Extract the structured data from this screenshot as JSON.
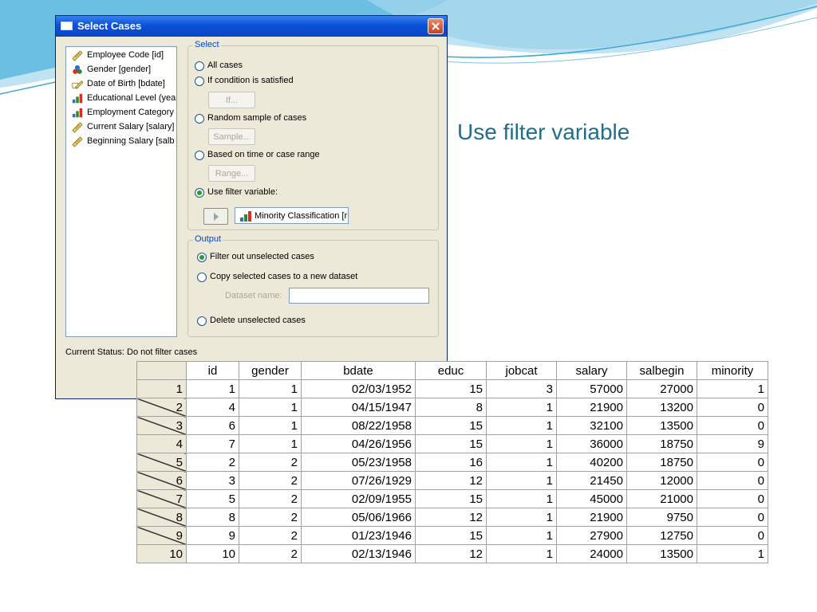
{
  "slide": {
    "title": "Use filter variable"
  },
  "dialog": {
    "title": "Select Cases",
    "variables": [
      {
        "label": "Employee Code [id]",
        "icon": "scale-ruler-icon"
      },
      {
        "label": "Gender [gender]",
        "icon": "nominal-icon"
      },
      {
        "label": "Date of Birth [bdate]",
        "icon": "date-ruler-icon"
      },
      {
        "label": "Educational Level (yea",
        "icon": "ordinal-bar-icon"
      },
      {
        "label": "Employment Category",
        "icon": "ordinal-bar-icon"
      },
      {
        "label": "Current Salary [salary]",
        "icon": "scale-ruler-icon"
      },
      {
        "label": "Beginning Salary [salb",
        "icon": "scale-ruler-icon"
      }
    ],
    "select": {
      "legend": "Select",
      "all_cases": "All cases",
      "if_condition": "If condition is satisfied",
      "if_button": "If...",
      "random_sample": "Random sample of cases",
      "sample_button": "Sample...",
      "time_range": "Based on time or case range",
      "range_button": "Range...",
      "use_filter": "Use filter variable:",
      "filter_variable": "Minority Classification [r",
      "selected": "use_filter"
    },
    "output": {
      "legend": "Output",
      "filter_out": "Filter out unselected cases",
      "copy_dataset": "Copy selected cases to a new dataset",
      "dataset_name_label": "Dataset name:",
      "dataset_name_value": "",
      "delete_unselected": "Delete unselected cases",
      "selected": "filter_out"
    },
    "status": "Current Status: Do not filter cases"
  },
  "table": {
    "columns": [
      "id",
      "gender",
      "bdate",
      "educ",
      "jobcat",
      "salary",
      "salbegin",
      "minority"
    ],
    "rows": [
      {
        "num": "1",
        "filtered": false,
        "cells": [
          "1",
          "1",
          "02/03/1952",
          "15",
          "3",
          "57000",
          "27000",
          "1"
        ]
      },
      {
        "num": "2",
        "filtered": true,
        "cells": [
          "4",
          "1",
          "04/15/1947",
          "8",
          "1",
          "21900",
          "13200",
          "0"
        ]
      },
      {
        "num": "3",
        "filtered": true,
        "cells": [
          "6",
          "1",
          "08/22/1958",
          "15",
          "1",
          "32100",
          "13500",
          "0"
        ]
      },
      {
        "num": "4",
        "filtered": false,
        "cells": [
          "7",
          "1",
          "04/26/1956",
          "15",
          "1",
          "36000",
          "18750",
          "9"
        ]
      },
      {
        "num": "5",
        "filtered": true,
        "cells": [
          "2",
          "2",
          "05/23/1958",
          "16",
          "1",
          "40200",
          "18750",
          "0"
        ]
      },
      {
        "num": "6",
        "filtered": true,
        "cells": [
          "3",
          "2",
          "07/26/1929",
          "12",
          "1",
          "21450",
          "12000",
          "0"
        ]
      },
      {
        "num": "7",
        "filtered": true,
        "cells": [
          "5",
          "2",
          "02/09/1955",
          "15",
          "1",
          "45000",
          "21000",
          "0"
        ]
      },
      {
        "num": "8",
        "filtered": true,
        "cells": [
          "8",
          "2",
          "05/06/1966",
          "12",
          "1",
          "21900",
          "9750",
          "0"
        ]
      },
      {
        "num": "9",
        "filtered": true,
        "cells": [
          "9",
          "2",
          "01/23/1946",
          "15",
          "1",
          "27900",
          "12750",
          "0"
        ]
      },
      {
        "num": "10",
        "filtered": false,
        "cells": [
          "10",
          "2",
          "02/13/1946",
          "12",
          "1",
          "24000",
          "13500",
          "1"
        ]
      }
    ]
  },
  "colors": {
    "title_text": "#1f6f8b",
    "titlebar": "#0a52d8",
    "accent_wave": "#4fb3d9",
    "group_legend": "#0046d5"
  }
}
